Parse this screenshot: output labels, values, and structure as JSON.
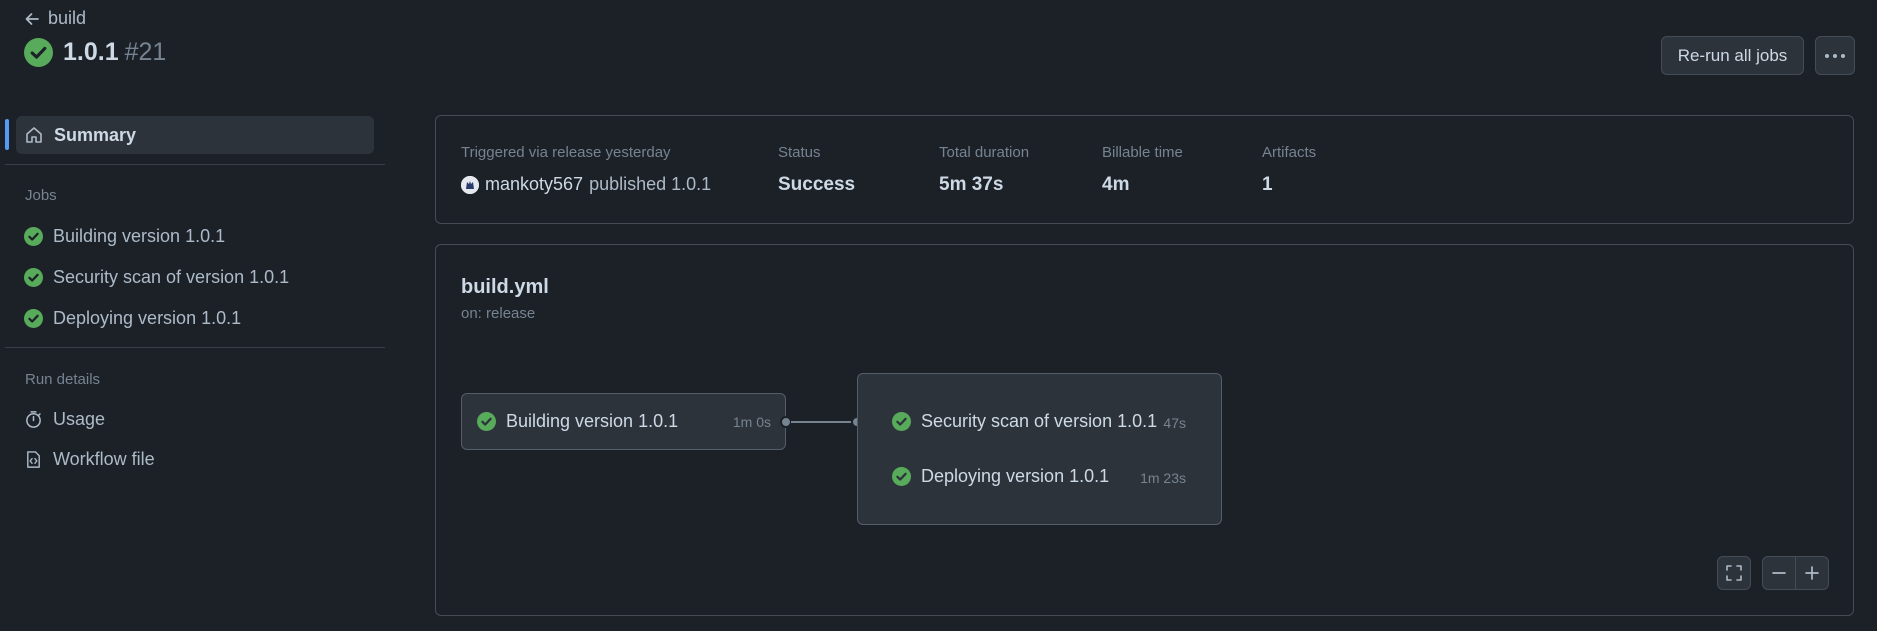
{
  "header": {
    "back_label": "build",
    "run_name": "1.0.1",
    "run_number": "#21",
    "rerun_label": "Re-run all jobs"
  },
  "sidebar": {
    "summary_label": "Summary",
    "jobs_heading": "Jobs",
    "jobs": [
      {
        "label": "Building version 1.0.1"
      },
      {
        "label": "Security scan of version 1.0.1"
      },
      {
        "label": "Deploying version 1.0.1"
      }
    ],
    "run_details_heading": "Run details",
    "details": [
      {
        "label": "Usage",
        "icon": "stopwatch-icon"
      },
      {
        "label": "Workflow file",
        "icon": "file-code-icon"
      }
    ]
  },
  "summary": {
    "trigger_label": "Triggered via release yesterday",
    "trigger_user": "mankoty567",
    "trigger_action": "published 1.0.1",
    "status_label": "Status",
    "status_value": "Success",
    "duration_label": "Total duration",
    "duration_value": "5m 37s",
    "billable_label": "Billable time",
    "billable_value": "4m",
    "artifacts_label": "Artifacts",
    "artifacts_value": "1"
  },
  "graph": {
    "workflow_file": "build.yml",
    "trigger": "on: release",
    "jobs": [
      {
        "label": "Building version 1.0.1",
        "duration": "1m 0s"
      },
      {
        "label": "Security scan of version 1.0.1",
        "duration": "47s"
      },
      {
        "label": "Deploying version 1.0.1",
        "duration": "1m 23s"
      }
    ]
  },
  "colors": {
    "background": "#1c2128",
    "success": "#57ab5a",
    "accent": "#539bf5",
    "border": "#444c56"
  }
}
